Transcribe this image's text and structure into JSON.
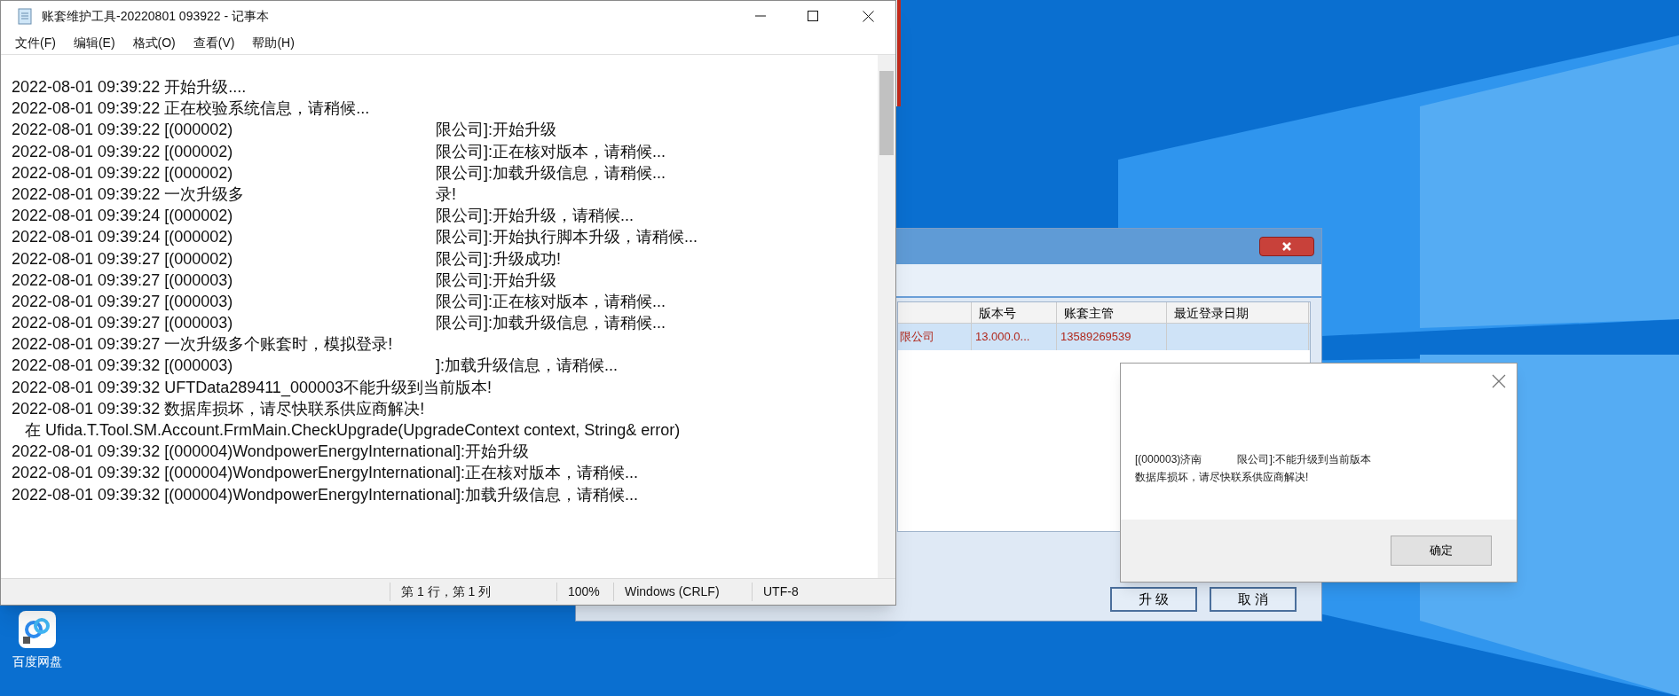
{
  "desktop_icons": [
    {
      "label": "百度网盘"
    }
  ],
  "notepad": {
    "title": "账套维护工具-20220801 093922 - 记事本",
    "menu": [
      "文件(F)",
      "编辑(E)",
      "格式(O)",
      "查看(V)",
      "帮助(H)"
    ],
    "lines": [
      {
        "text": "2022-08-01 09:39:22 开始升级...."
      },
      {
        "text": "2022-08-01 09:39:22 正在校验系统信息，请稍候..."
      },
      {
        "text": "2022-08-01 09:39:22 [(000002)",
        "tail": "限公司]:开始升级"
      },
      {
        "text": "2022-08-01 09:39:22 [(000002)",
        "tail": "限公司]:正在核对版本，请稍候..."
      },
      {
        "text": "2022-08-01 09:39:22 [(000002)",
        "tail": "限公司]:加载升级信息，请稍候..."
      },
      {
        "text": "2022-08-01 09:39:22 一次升级多",
        "tail": "录!"
      },
      {
        "text": "2022-08-01 09:39:24 [(000002)",
        "tail": "限公司]:开始升级，请稍候..."
      },
      {
        "text": "2022-08-01 09:39:24 [(000002)",
        "tail": "限公司]:开始执行脚本升级，请稍候..."
      },
      {
        "text": "2022-08-01 09:39:27 [(000002)",
        "tail": "限公司]:升级成功!"
      },
      {
        "text": "2022-08-01 09:39:27 [(000003)",
        "tail": "限公司]:开始升级"
      },
      {
        "text": "2022-08-01 09:39:27 [(000003)",
        "tail": "限公司]:正在核对版本，请稍候..."
      },
      {
        "text": "2022-08-01 09:39:27 [(000003)",
        "tail": "限公司]:加载升级信息，请稍候..."
      },
      {
        "text": "2022-08-01 09:39:27 一次升级多个账套时，模拟登录!"
      },
      {
        "text": "2022-08-01 09:39:32 [(000003)",
        "tail": "]:加载升级信息，请稍候..."
      },
      {
        "text": "2022-08-01 09:39:32 UFTData289411_000003不能升级到当前版本!"
      },
      {
        "text": "2022-08-01 09:39:32 数据库损坏，请尽快联系供应商解决!"
      },
      {
        "text": "   在 Ufida.T.Tool.SM.Account.FrmMain.CheckUpgrade(UpgradeContext context, String& error)"
      },
      {
        "text": "2022-08-01 09:39:32 [(000004)WondpowerEnergyInternational]:开始升级"
      },
      {
        "text": "2022-08-01 09:39:32 [(000004)WondpowerEnergyInternational]:正在核对版本，请稍候..."
      },
      {
        "text": "2022-08-01 09:39:32 [(000004)WondpowerEnergyInternational]:加载升级信息，请稍候..."
      }
    ],
    "status": [
      "第 1 行，第 1 列",
      "100%",
      "Windows (CRLF)",
      "UTF-8"
    ]
  },
  "upgrade_window": {
    "columns": [
      "版本号",
      "账套主管",
      "最近登录日期"
    ],
    "rows": [
      {
        "selected": true,
        "name_fragment": "限公司",
        "cells": [
          "13.000.0...",
          "13589269539"
        ]
      }
    ],
    "buttons": [
      "升 级",
      "取 消"
    ]
  },
  "message_box": {
    "message_start": "[(000003)济南",
    "message_end": "限公司]:不能升级到当前版本",
    "message_line2": "数据库损坏，请尽快联系供应商解决!",
    "button": "确定"
  }
}
